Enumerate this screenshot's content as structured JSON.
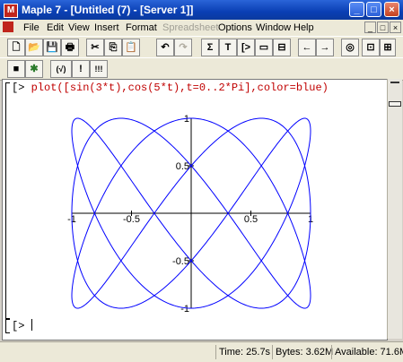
{
  "window": {
    "title": "Maple 7 - [Untitled (7) - [Server 1]]",
    "app_icon_letter": "M"
  },
  "window_controls": {
    "minimize": "_",
    "maximize": "□",
    "close": "×"
  },
  "menu": {
    "items": [
      {
        "label": "File"
      },
      {
        "label": "Edit"
      },
      {
        "label": "View"
      },
      {
        "label": "Insert"
      },
      {
        "label": "Format"
      },
      {
        "label": "Spreadsheet",
        "disabled": true
      },
      {
        "label": "Options"
      },
      {
        "label": "Window"
      },
      {
        "label": "Help"
      }
    ]
  },
  "toolbar1_icons": [
    {
      "name": "new-document-icon",
      "glyph": "🗋"
    },
    {
      "name": "open-icon",
      "glyph": "📂"
    },
    {
      "name": "save-icon",
      "glyph": "💾"
    },
    {
      "name": "print-icon",
      "glyph": "🖶"
    },
    {
      "name": "cut-icon",
      "glyph": "✂"
    },
    {
      "name": "copy-icon",
      "glyph": "⎘"
    },
    {
      "name": "paste-icon",
      "glyph": "📋"
    },
    {
      "name": "undo-icon",
      "glyph": "↶"
    },
    {
      "name": "redo-icon",
      "glyph": "↷",
      "disabled": true
    },
    {
      "name": "sum-icon",
      "glyph": "Σ"
    },
    {
      "name": "text-icon",
      "glyph": "T"
    },
    {
      "name": "math-input-icon",
      "glyph": "[>"
    },
    {
      "name": "insert-region-icon",
      "glyph": "▭"
    },
    {
      "name": "collapse-icon",
      "glyph": "⊟"
    },
    {
      "name": "back-icon",
      "glyph": "←"
    },
    {
      "name": "forward-icon",
      "glyph": "→"
    },
    {
      "name": "stop-icon",
      "glyph": "◎"
    },
    {
      "name": "zoom-100-icon",
      "glyph": "⊡"
    },
    {
      "name": "zoom-150-icon",
      "glyph": "⊞"
    },
    {
      "name": "zoom-200-icon",
      "glyph": "⊠"
    }
  ],
  "toolbar2_icons": [
    {
      "name": "stop-computation-icon",
      "glyph": "■"
    },
    {
      "name": "debug-icon",
      "glyph": "✱"
    },
    {
      "name": "restart-icon",
      "glyph": "(√)"
    },
    {
      "name": "execute-icon",
      "glyph": "!"
    },
    {
      "name": "execute-all-icon",
      "glyph": "!!!"
    }
  ],
  "document": {
    "input_command": "plot([sin(3*t),cos(5*t),t=0..2*Pi],color=blue)",
    "prompt": "[>"
  },
  "plot": {
    "x_tick_labels": [
      "-1",
      "-0.5",
      "0.5",
      "1"
    ],
    "y_tick_labels": [
      "1",
      "0.5",
      "-0.5",
      "-1"
    ]
  },
  "chart_data": {
    "type": "line",
    "parametric": true,
    "x_expression": "sin(3*t)",
    "y_expression": "cos(5*t)",
    "t_range": [
      0,
      6.283185
    ],
    "color": "#0000ff",
    "xlim": [
      -1,
      1
    ],
    "ylim": [
      -1,
      1
    ],
    "x_ticks": [
      -1,
      -0.5,
      0.5,
      1
    ],
    "y_ticks": [
      -1,
      -0.5,
      0.5,
      1
    ],
    "grid": false
  },
  "status": {
    "time": "Time: 25.7s",
    "bytes": "Bytes: 3.62M",
    "available": "Available: 71.6M"
  }
}
